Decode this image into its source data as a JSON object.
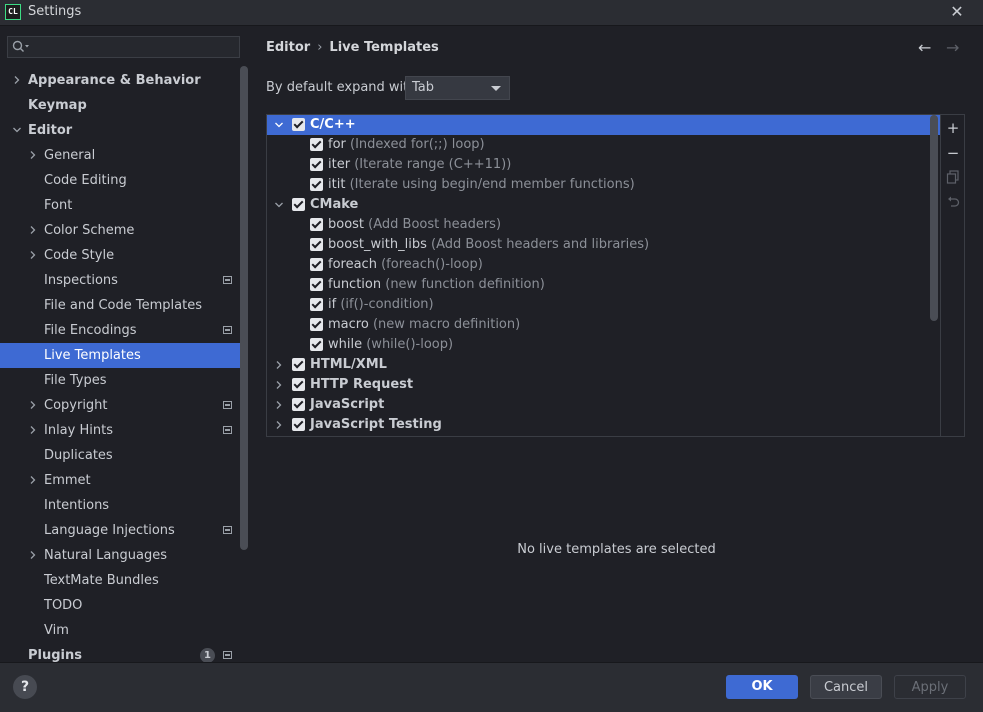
{
  "window": {
    "title": "Settings",
    "logo_text": "CL"
  },
  "search": {
    "placeholder": ""
  },
  "sidebar": {
    "items": [
      {
        "label": "Appearance & Behavior",
        "level": 0,
        "bold": true,
        "expandable": true,
        "expanded": false
      },
      {
        "label": "Keymap",
        "level": 0,
        "bold": true,
        "expandable": false
      },
      {
        "label": "Editor",
        "level": 0,
        "bold": true,
        "expandable": true,
        "expanded": true
      },
      {
        "label": "General",
        "level": 1,
        "expandable": true,
        "expanded": false
      },
      {
        "label": "Code Editing",
        "level": 1
      },
      {
        "label": "Font",
        "level": 1
      },
      {
        "label": "Color Scheme",
        "level": 1,
        "expandable": true,
        "expanded": false
      },
      {
        "label": "Code Style",
        "level": 1,
        "expandable": true,
        "expanded": false
      },
      {
        "label": "Inspections",
        "level": 1,
        "project": true
      },
      {
        "label": "File and Code Templates",
        "level": 1
      },
      {
        "label": "File Encodings",
        "level": 1,
        "project": true
      },
      {
        "label": "Live Templates",
        "level": 1,
        "selected": true
      },
      {
        "label": "File Types",
        "level": 1
      },
      {
        "label": "Copyright",
        "level": 1,
        "expandable": true,
        "expanded": false,
        "project": true
      },
      {
        "label": "Inlay Hints",
        "level": 1,
        "expandable": true,
        "expanded": false,
        "project": true
      },
      {
        "label": "Duplicates",
        "level": 1
      },
      {
        "label": "Emmet",
        "level": 1,
        "expandable": true,
        "expanded": false
      },
      {
        "label": "Intentions",
        "level": 1
      },
      {
        "label": "Language Injections",
        "level": 1,
        "project": true
      },
      {
        "label": "Natural Languages",
        "level": 1,
        "expandable": true,
        "expanded": false
      },
      {
        "label": "TextMate Bundles",
        "level": 1
      },
      {
        "label": "TODO",
        "level": 1
      },
      {
        "label": "Vim",
        "level": 1
      },
      {
        "label": "Plugins",
        "level": 0,
        "bold": true,
        "badge": "1",
        "project": true
      }
    ]
  },
  "breadcrumb": {
    "parent": "Editor",
    "separator": "›",
    "current": "Live Templates"
  },
  "expand": {
    "label": "By default expand with",
    "value": "Tab"
  },
  "templates": [
    {
      "type": "group",
      "name": "C/C++",
      "checked": true,
      "expanded": true,
      "selected": true
    },
    {
      "type": "item",
      "abbr": "for",
      "desc": "(Indexed for(;;) loop)",
      "checked": true
    },
    {
      "type": "item",
      "abbr": "iter",
      "desc": "(Iterate range (C++11))",
      "checked": true
    },
    {
      "type": "item",
      "abbr": "itit",
      "desc": "(Iterate using begin/end member functions)",
      "checked": true
    },
    {
      "type": "group",
      "name": "CMake",
      "checked": true,
      "expanded": true
    },
    {
      "type": "item",
      "abbr": "boost",
      "desc": "(Add Boost headers)",
      "checked": true
    },
    {
      "type": "item",
      "abbr": "boost_with_libs",
      "desc": "(Add Boost headers and libraries)",
      "checked": true
    },
    {
      "type": "item",
      "abbr": "foreach",
      "desc": "(foreach()-loop)",
      "checked": true
    },
    {
      "type": "item",
      "abbr": "function",
      "desc": "(new function definition)",
      "checked": true
    },
    {
      "type": "item",
      "abbr": "if",
      "desc": "(if()-condition)",
      "checked": true
    },
    {
      "type": "item",
      "abbr": "macro",
      "desc": "(new macro definition)",
      "checked": true
    },
    {
      "type": "item",
      "abbr": "while",
      "desc": "(while()-loop)",
      "checked": true
    },
    {
      "type": "group",
      "name": "HTML/XML",
      "checked": true,
      "expanded": false
    },
    {
      "type": "group",
      "name": "HTTP Request",
      "checked": true,
      "expanded": false
    },
    {
      "type": "group",
      "name": "JavaScript",
      "checked": true,
      "expanded": false
    },
    {
      "type": "group",
      "name": "JavaScript Testing",
      "checked": true,
      "expanded": false
    }
  ],
  "toolbar": {
    "add": "+",
    "remove": "−",
    "copy_icon": "copy-icon",
    "restore_icon": "restore-icon"
  },
  "empty_message": "No live templates are selected",
  "footer": {
    "help": "?",
    "ok": "OK",
    "cancel": "Cancel",
    "apply": "Apply"
  },
  "colors": {
    "accent": "#3e6ad3",
    "background": "#1f2026",
    "panel": "#2b2d33"
  }
}
